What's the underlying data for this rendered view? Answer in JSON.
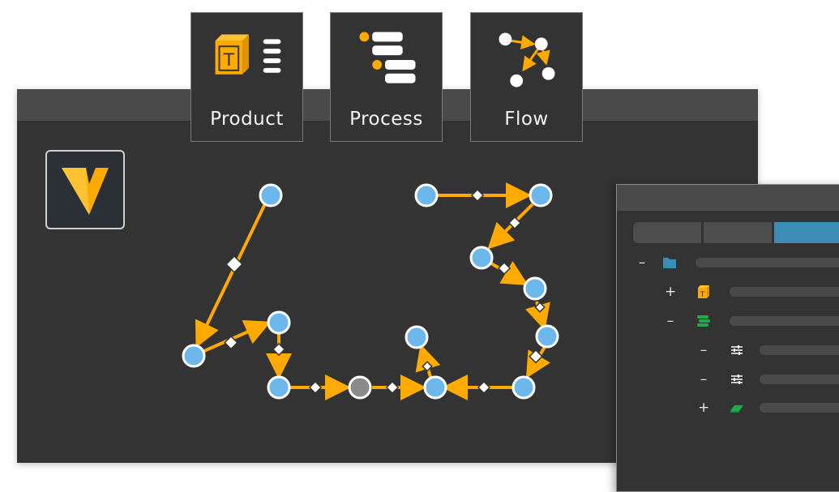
{
  "tabs": [
    {
      "label": "Product",
      "icon": "product-icon"
    },
    {
      "label": "Process",
      "icon": "process-icon"
    },
    {
      "label": "Flow",
      "icon": "flow-icon"
    }
  ],
  "colors": {
    "accent": "#FFAA00",
    "node": "#6CB8EC",
    "node_inactive": "#8A8A8A",
    "active_tab": "#3B8DB8",
    "green": "#22A84F",
    "window_bg": "#333333",
    "titlebar": "#4A4A4A"
  },
  "tree": {
    "rows": [
      {
        "toggle": "–",
        "icon": "folder-icon"
      },
      {
        "toggle": "+",
        "icon": "product-box-icon"
      },
      {
        "toggle": "–",
        "icon": "process-stack-icon"
      },
      {
        "toggle": "–",
        "icon": "sliders-icon"
      },
      {
        "toggle": "–",
        "icon": "sliders-icon"
      },
      {
        "toggle": "+",
        "icon": "part-icon"
      }
    ]
  }
}
